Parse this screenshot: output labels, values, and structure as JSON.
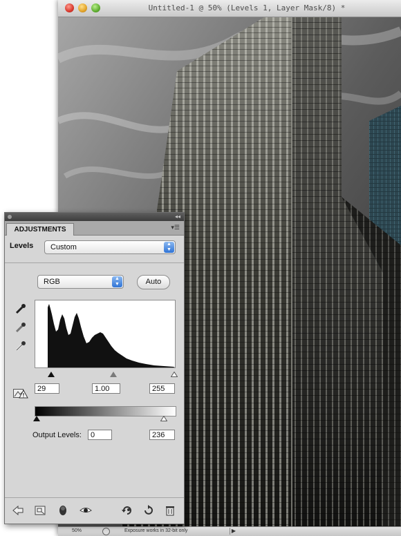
{
  "document": {
    "title": "Untitled-1 @ 50% (Levels 1, Layer Mask/8) *",
    "status": {
      "zoom": "50%",
      "message": "Exposure works in 32-bit only"
    }
  },
  "panel": {
    "tab_label": "ADJUSTMENTS",
    "adjustment_label": "Levels",
    "preset_value": "Custom",
    "channel_value": "RGB",
    "auto_label": "Auto",
    "input_levels": {
      "black": "29",
      "gamma": "1.00",
      "white": "255"
    },
    "output_label": "Output Levels:",
    "output_levels": {
      "black": "0",
      "white": "236"
    }
  },
  "icons": {
    "eyedroppers": [
      "black-point-eyedropper-icon",
      "gray-point-eyedropper-icon",
      "white-point-eyedropper-icon"
    ],
    "toolbar": [
      "back-arrow-icon",
      "expand-view-icon",
      "clip-to-layer-icon",
      "visibility-eye-icon",
      "view-previous-state-icon",
      "reset-icon",
      "trash-icon"
    ]
  },
  "colors": {
    "accent": "#2f74d6",
    "panel_bg": "#d6d6d6"
  }
}
